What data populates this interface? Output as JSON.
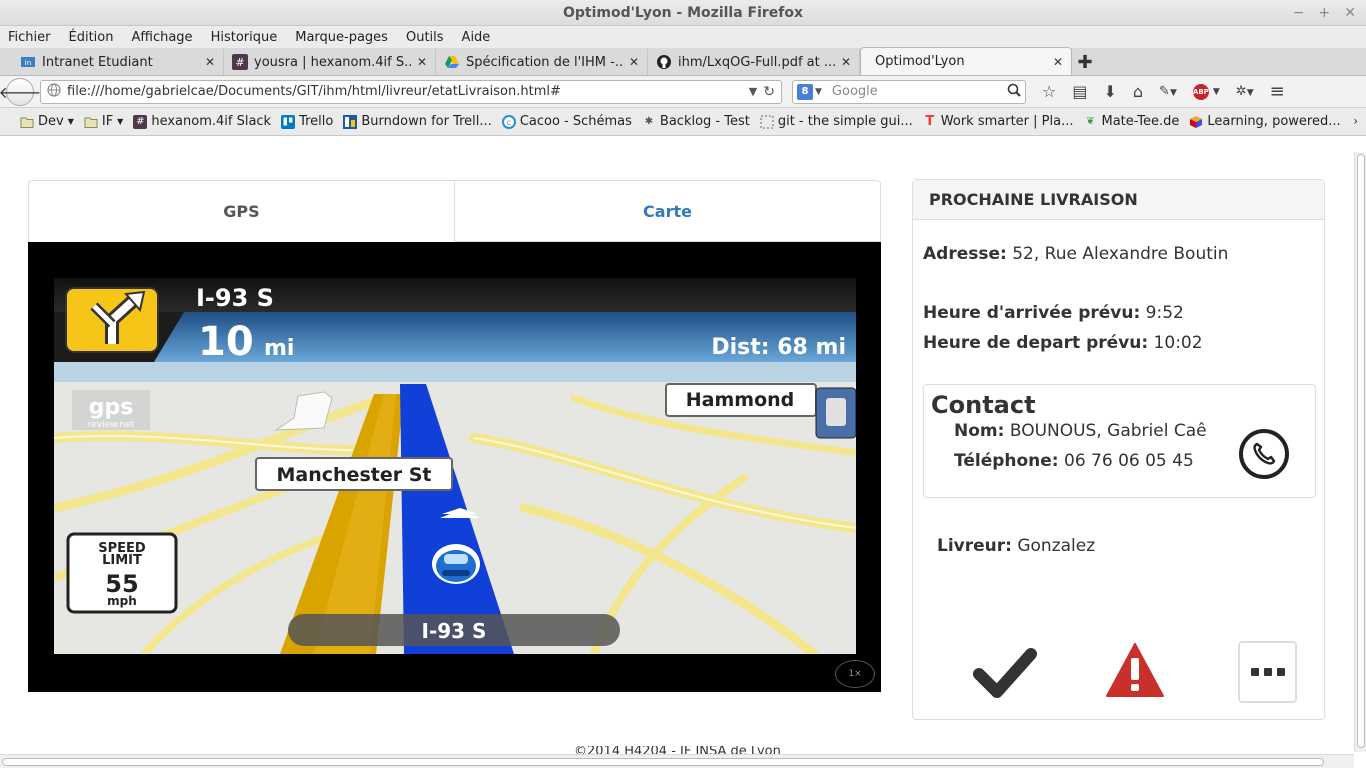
{
  "window": {
    "title": "Optimod'Lyon - Mozilla Firefox",
    "controls": [
      "−",
      "+",
      "✕"
    ]
  },
  "menubar": [
    "Fichier",
    "Édition",
    "Affichage",
    "Historique",
    "Marque-pages",
    "Outils",
    "Aide"
  ],
  "tabs": [
    {
      "title": "Intranet Etudiant",
      "icon": "insa-icon",
      "active": false
    },
    {
      "title": "yousra | hexanom.4if S...",
      "icon": "slack-icon",
      "active": false
    },
    {
      "title": "Spécification de l'IHM -...",
      "icon": "google-drive-icon",
      "active": false
    },
    {
      "title": "ihm/LxqOG-Full.pdf at ...",
      "icon": "github-icon",
      "active": false
    },
    {
      "title": "Optimod'Lyon",
      "icon": "",
      "active": true
    }
  ],
  "navbar": {
    "url": "file:///home/gabrielcae/Documents/GIT/ihm/html/livreur/etatLivraison.html#",
    "search_placeholder": "Google",
    "search_engine_badge": "8"
  },
  "bookmarks": [
    {
      "label": "Dev",
      "icon": "folder-icon",
      "dropdown": true
    },
    {
      "label": "IF",
      "icon": "folder-icon",
      "dropdown": true
    },
    {
      "label": "hexanom.4if Slack",
      "icon": "slack-icon"
    },
    {
      "label": "Trello",
      "icon": "trello-icon"
    },
    {
      "label": "Burndown for Trell...",
      "icon": "burndown-icon"
    },
    {
      "label": "Cacoo - Schémas",
      "icon": "cacoo-icon"
    },
    {
      "label": "Backlog - Test",
      "icon": "bug-icon"
    },
    {
      "label": "git - the simple gui...",
      "icon": "dotted-square-icon"
    },
    {
      "label": "Work smarter | Pla...",
      "icon": "t-logo-icon"
    },
    {
      "label": "Mate-Tee.de",
      "icon": "leaf-icon"
    },
    {
      "label": "Learning, powered...",
      "icon": "cube-icon"
    }
  ],
  "page": {
    "tabs": {
      "gps": "GPS",
      "carte": "Carte"
    },
    "gps": {
      "road": "I-93 S",
      "distance_next": "10",
      "distance_unit": "mi",
      "dist_total": "Dist: 68 mi",
      "label_hammond": "Hammond",
      "label_manchester": "Manchester St",
      "speed_limit_top": "SPEED",
      "speed_limit_mid": "LIMIT",
      "speed_limit_value": "55",
      "speed_limit_unit": "mph",
      "bottom_road": "I-93 S",
      "watermark_top": "gps",
      "watermark_bottom": "review.net",
      "zoom_indicator": "1×"
    },
    "livraison": {
      "header": "PROCHAINE LIVRAISON",
      "adresse_label": "Adresse:",
      "adresse_value": " 52, Rue Alexandre Boutin",
      "arrivee_label": "Heure d'arrivée prévu:",
      "arrivee_value": " 9:52",
      "depart_label": "Heure de depart prévu:",
      "depart_value": " 10:02",
      "contact_title": "Contact",
      "nom_label": "Nom:",
      "nom_value": " BOUNOUS, Gabriel Caê",
      "tel_label": "Téléphone:",
      "tel_value": " 06 76 06 05 45",
      "livreur_label": "Livreur:",
      "livreur_value": " Gonzalez"
    },
    "footer": "©2014 H4204 - IF INSA de Lyon"
  },
  "colors": {
    "link": "#337ab7",
    "warning": "#c9302c",
    "dark": "#333333"
  }
}
